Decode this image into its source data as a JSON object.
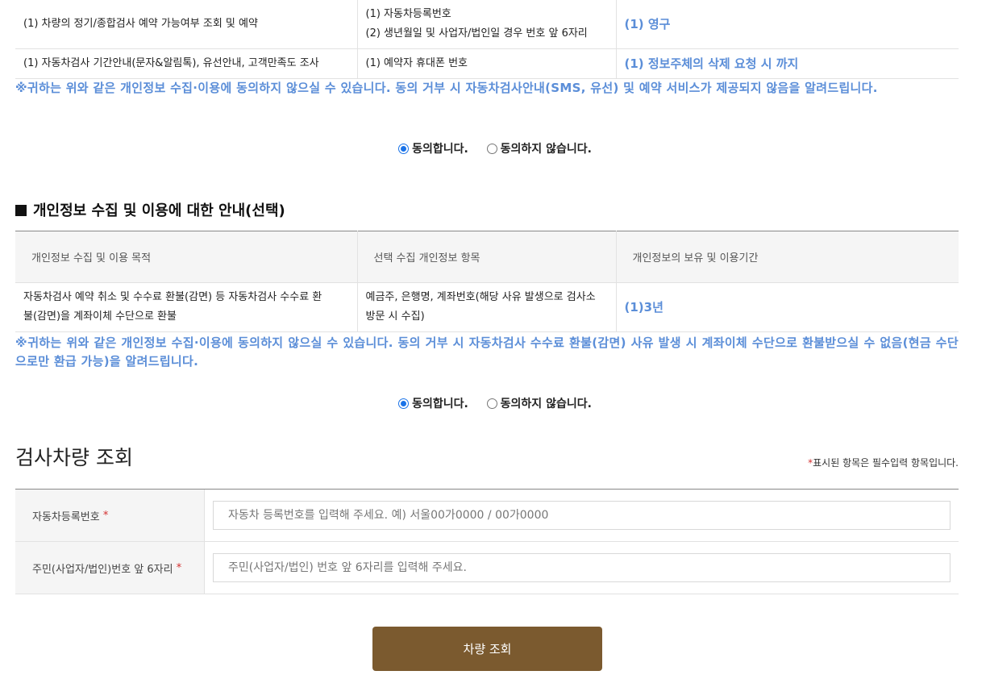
{
  "table1": {
    "rows": [
      {
        "purpose": "(1) 차량의 정기/종합검사 예약 가능여부 조회 및 예약",
        "items": [
          "(1) 자동차등록번호",
          "(2) 생년월일 및 사업자/법인일 경우 번호 앞 6자리"
        ],
        "period": "(1) 영구"
      },
      {
        "purpose": "(1) 자동차검사 기간안내(문자&알림톡), 유선안내, 고객만족도 조사",
        "items": [
          "(1) 예약자 휴대폰 번호"
        ],
        "period": "(1) 정보주체의 삭제 요청 시 까지"
      }
    ]
  },
  "notice1": "※귀하는 위와 같은 개인정보 수집·이용에 동의하지 않으실 수 있습니다. 동의 거부 시 자동차검사안내(SMS, 유선) 및 예약 서비스가 제공되지 않음을 알려드립니다.",
  "consent1": {
    "agree": "동의합니다.",
    "disagree": "동의하지 않습니다.",
    "selected": "agree"
  },
  "section2": {
    "title": "개인정보 수집 및 이용에 대한 안내(선택)",
    "headers": [
      "개인정보 수집 및 이용 목적",
      "선택 수집 개인정보 항목",
      "개인정보의 보유 및 이용기간"
    ],
    "row": {
      "purpose_l1": "자동차검사 예약 취소 및 수수료 환불(감면) 등 자동차검사 수수료 환",
      "purpose_l2": "불(감면)을 계좌이체 수단으로 환불",
      "items_l1": "예금주, 은행명, 계좌번호(해당 사유 발생으로 검사소",
      "items_l2": "방문 시 수집)",
      "period": "(1)3년"
    }
  },
  "notice2": "※귀하는 위와 같은 개인정보 수집·이용에 동의하지 않으실 수 있습니다. 동의 거부 시 자동차검사 수수료 환불(감면) 사유 발생 시 계좌이체 수단으로 환불받으실 수 없음(현금 수단으로만 환급 가능)을 알려드립니다.",
  "consent2": {
    "agree": "동의합니다.",
    "disagree": "동의하지 않습니다.",
    "selected": "agree"
  },
  "lookup": {
    "title": "검사차량 조회",
    "required_star": "*",
    "required_note": "표시된 항목은 필수입력 항목입니다.",
    "fields": [
      {
        "label": "자동차등록번호",
        "placeholder": "자동차 등록번호를 입력해 주세요. 예) 서울00가0000 / 00가0000"
      },
      {
        "label": "주민(사업자/법인)번호 앞 6자리",
        "placeholder": "주민(사업자/법인) 번호 앞 6자리를 입력해 주세요."
      }
    ],
    "submit_label": "차량 조회"
  },
  "colors": {
    "accent_blue": "#5b8ed8",
    "button_brown": "#7b5a2f",
    "required_red": "#d32f2f"
  }
}
